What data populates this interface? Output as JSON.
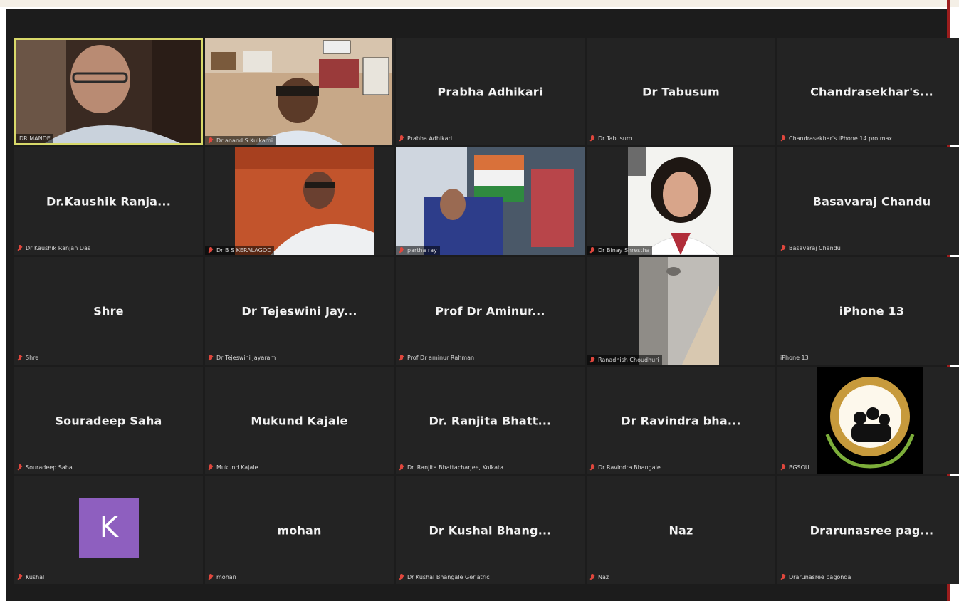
{
  "colors": {
    "background": "#1c1c1c",
    "tile": "#232323",
    "active_border": "#d8d96a",
    "muted_mic": "#e0473d",
    "avatar": "#8e5fbf"
  },
  "participants": [
    {
      "display": "",
      "label": "DR MANDE",
      "video": true
    },
    {
      "display": "",
      "label": "Dr anand S Kulkarni",
      "video": true
    },
    {
      "display": "Prabha Adhikari",
      "label": "Prabha Adhikari",
      "video": false
    },
    {
      "display": "Dr Tabusum",
      "label": "Dr Tabusum",
      "video": false
    },
    {
      "display": "Chandrasekhar's...",
      "label": "Chandrasekhar's iPhone 14 pro max",
      "video": false
    },
    {
      "display": "Dr.Kaushik  Ranja...",
      "label": "Dr Kaushik Ranjan Das",
      "video": false
    },
    {
      "display": "",
      "label": "Dr B S KERALAGOD",
      "video": true
    },
    {
      "display": "",
      "label": "partha ray",
      "video": true
    },
    {
      "display": "",
      "label": "Dr Binay Shrestha",
      "video": true
    },
    {
      "display": "Basavaraj Chandu",
      "label": "Basavaraj Chandu",
      "video": false
    },
    {
      "display": "Shre",
      "label": "Shre",
      "video": false
    },
    {
      "display": "Dr Tejeswini Jay...",
      "label": "Dr Tejeswini Jayaram",
      "video": false
    },
    {
      "display": "Prof Dr Aminur...",
      "label": "Prof Dr aminur Rahman",
      "video": false
    },
    {
      "display": "",
      "label": "Ranadhish Choudhuri",
      "video": true
    },
    {
      "display": "iPhone 13",
      "label": "iPhone 13",
      "video": false
    },
    {
      "display": "Souradeep Saha",
      "label": "Souradeep Saha",
      "video": false
    },
    {
      "display": "Mukund Kajale",
      "label": "Mukund Kajale",
      "video": false
    },
    {
      "display": "Dr. Ranjita Bhatt...",
      "label": "Dr. Ranjita Bhattacharjee, Kolkata",
      "video": false
    },
    {
      "display": "Dr Ravindra bha...",
      "label": "Dr Ravindra Bhangale",
      "video": false
    },
    {
      "display": "",
      "label": "BGSOU",
      "video": true
    },
    {
      "display": "",
      "label": "Kushal",
      "avatar_letter": "K",
      "video": false
    },
    {
      "display": "mohan",
      "label": "mohan",
      "video": false
    },
    {
      "display": "Dr Kushal Bhang...",
      "label": "Dr Kushal Bhangale Geriatric",
      "video": false
    },
    {
      "display": "Naz",
      "label": "Naz",
      "video": false
    },
    {
      "display": "Drarunasree pag...",
      "label": "Drarunasree pagonda",
      "video": false
    }
  ]
}
